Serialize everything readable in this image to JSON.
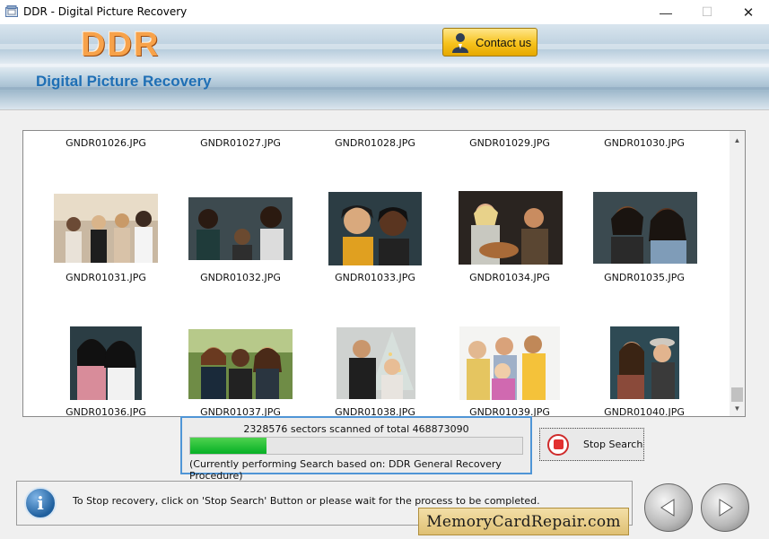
{
  "window": {
    "title": "DDR - Digital Picture Recovery",
    "minimize_glyph": "—",
    "maximize_glyph": "☐",
    "close_glyph": "✕"
  },
  "banner": {
    "logo": "DDR",
    "subtitle": "Digital Picture Recovery",
    "contact_label": "Contact us"
  },
  "gallery": {
    "row1": [
      "GNDR01026.JPG",
      "GNDR01027.JPG",
      "GNDR01028.JPG",
      "GNDR01029.JPG",
      "GNDR01030.JPG"
    ],
    "row2": [
      "GNDR01031.JPG",
      "GNDR01032.JPG",
      "GNDR01033.JPG",
      "GNDR01034.JPG",
      "GNDR01035.JPG"
    ],
    "row3": [
      "GNDR01036.JPG",
      "GNDR01037.JPG",
      "GNDR01038.JPG",
      "GNDR01039.JPG",
      "GNDR01040.JPG"
    ]
  },
  "progress": {
    "sectors_text": "2328576 sectors scanned of total 468873090",
    "fraction": 0.23,
    "procedure_text": "(Currently performing Search based on:  DDR General Recovery Procedure)"
  },
  "stop_button": {
    "label": "Stop Search"
  },
  "status": {
    "info_glyph": "i",
    "text": "To Stop recovery, click on 'Stop Search' Button or please wait for the process to be completed."
  },
  "watermark": "MemoryCardRepair.com",
  "scroll": {
    "up_glyph": "▲",
    "down_glyph": "▼"
  }
}
